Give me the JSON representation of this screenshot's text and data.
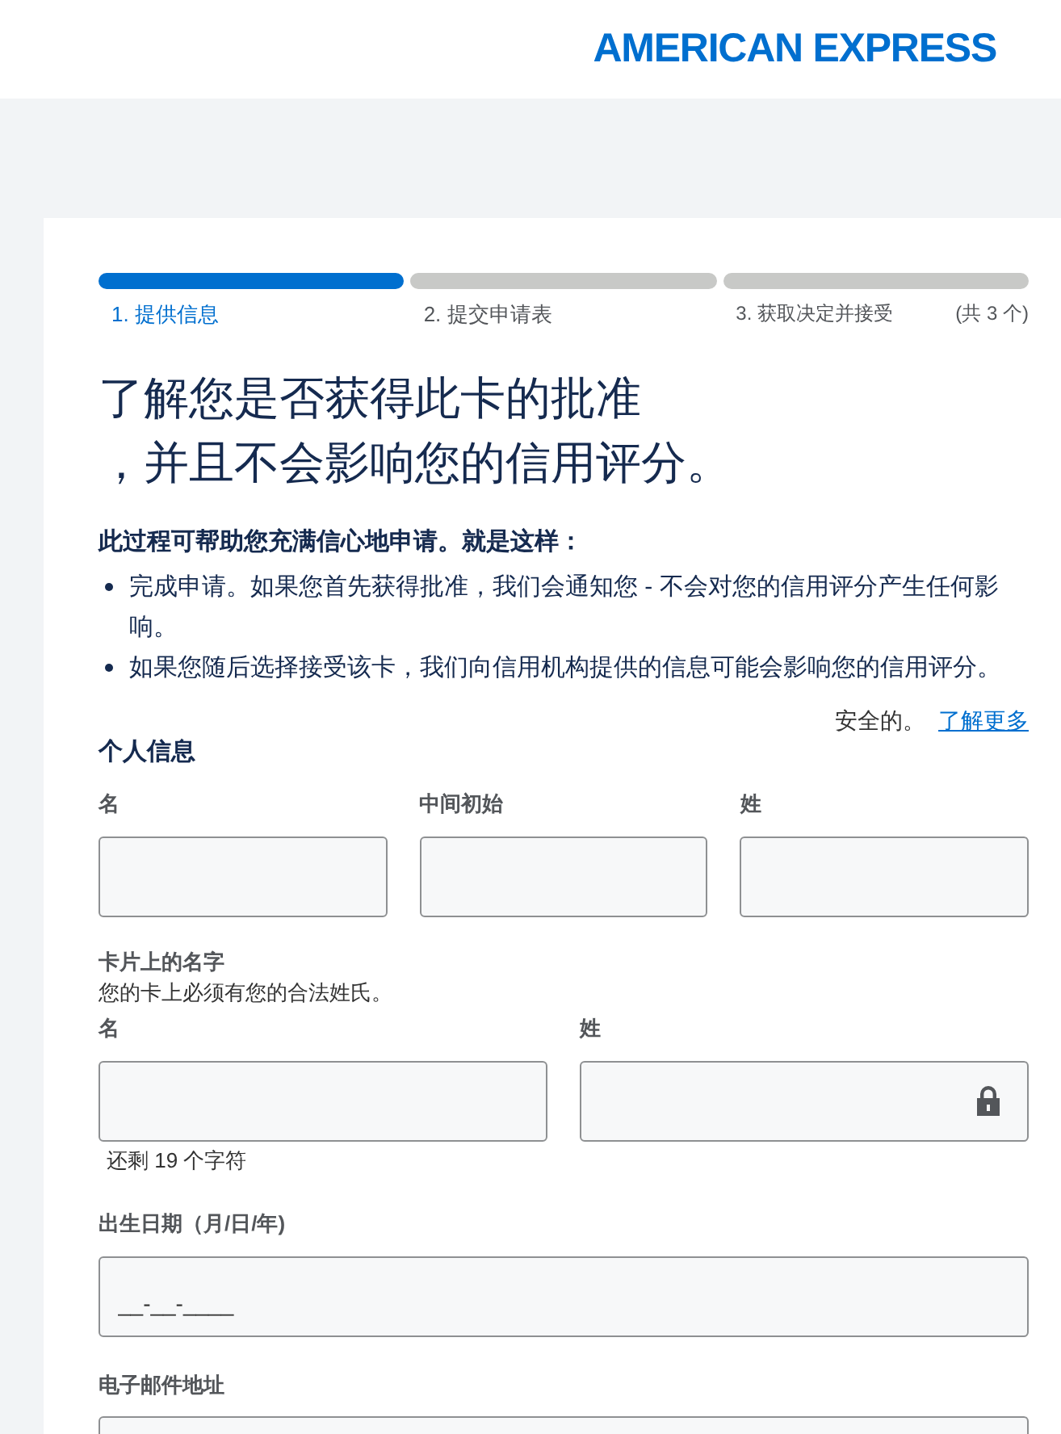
{
  "header": {
    "logo": "AMERICAN EXPRESS"
  },
  "steps": [
    {
      "label": "1. 提供信息",
      "selected": true
    },
    {
      "label": "2. 提交申请表",
      "selected": false
    },
    {
      "label": "3. 获取决定并接受",
      "selected": false
    }
  ],
  "step_count": "(共 3 个)",
  "heading_lines": [
    "了解您是否获得此卡的批准",
    "，并且不会影响您的信用评分。"
  ],
  "intro": {
    "title": "此过程可帮助您充满信心地申请。就是这样：",
    "bullets": [
      "完成申请。如果您首先获得批准，我们会通知您 - 不会对您的信用评分产生任何影响。",
      "如果您随后选择接受该卡，我们向信用机构提供的信息可能会影响您的信用评分。"
    ]
  },
  "security": {
    "text": "安全的。",
    "link": "了解更多"
  },
  "personal": {
    "title": "个人信息",
    "fields": [
      {
        "label": "名"
      },
      {
        "label": "中间初始"
      },
      {
        "label": "姓"
      }
    ]
  },
  "card_name": {
    "title": "卡片上的名字",
    "hint": "您的卡上必须有您的合法姓氏。",
    "fields": [
      {
        "label": "名",
        "locked": false
      },
      {
        "label": "姓",
        "locked": true
      }
    ],
    "remaining": "还剩 19 个字符"
  },
  "dob": {
    "label": "出生日期（月/日/年)",
    "placeholder": "__-__-____"
  },
  "email": {
    "label": "电子邮件地址"
  }
}
